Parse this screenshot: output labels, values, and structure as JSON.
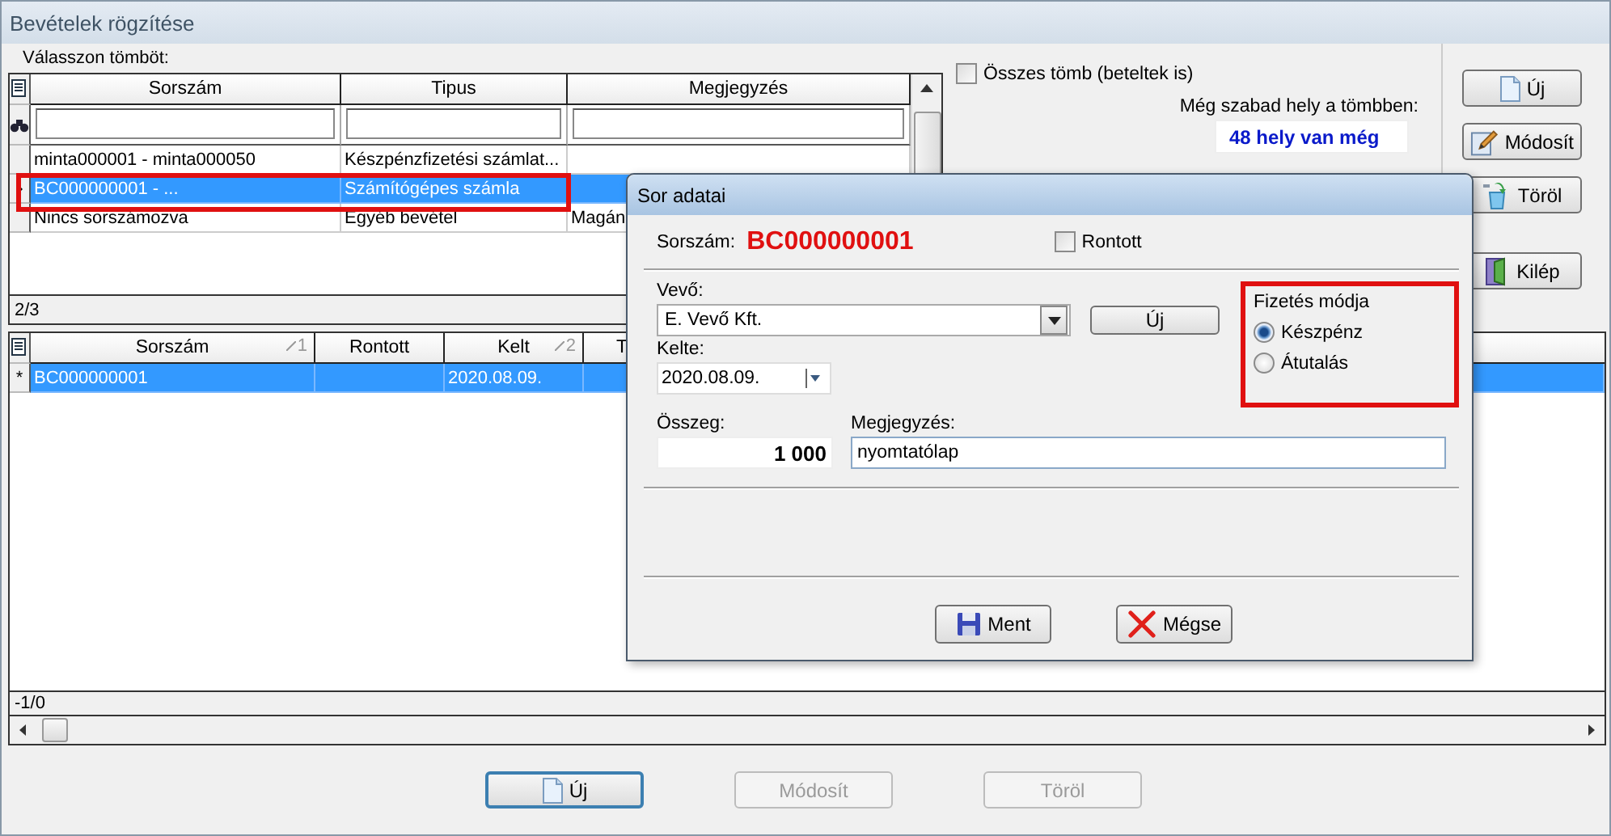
{
  "window": {
    "title": "Bevételek rögzítése"
  },
  "block_picker": {
    "label": "Válasszon tömböt:",
    "columns": [
      "Sorszám",
      "Tipus",
      "Megjegyzés"
    ],
    "rows": [
      {
        "sorszam": "minta000001 - minta000050",
        "tipus": "Készpénzfizetési számlat...",
        "selected": false
      },
      {
        "sorszam": "BC000000001 - ...",
        "tipus": "Számítógépes számla",
        "selected": true
      },
      {
        "sorszam": "Nincs sorszámozva",
        "tipus": "Egyéb bevétel",
        "megjegyzes": "Magán",
        "selected": false
      }
    ],
    "status": "2/3"
  },
  "all_blocks": {
    "label": "Összes tömb (beteltek is)",
    "checked": false
  },
  "free_space": {
    "label": "Még szabad hely a tömbben:",
    "value": "48 hely van még"
  },
  "side_buttons": [
    {
      "label": "Új",
      "kind": "new"
    },
    {
      "label": "Módosít",
      "kind": "edit"
    },
    {
      "label": "Töröl",
      "kind": "delete"
    },
    {
      "label": "Kilép",
      "kind": "exit"
    }
  ],
  "items_grid": {
    "columns": [
      {
        "label": "Sorszám",
        "sort": "1"
      },
      {
        "label": "Rontott"
      },
      {
        "label": "Kelt",
        "sort": "2"
      },
      {
        "label": "T"
      }
    ],
    "rows": [
      {
        "marker": "*",
        "sorszam": "BC000000001",
        "kelt": "2020.08.09.",
        "selected": true
      }
    ],
    "status": "-1/0"
  },
  "bottom_buttons": [
    {
      "label": "Új",
      "kind": "new",
      "disabled": false,
      "focused": true
    },
    {
      "label": "Módosít",
      "disabled": true,
      "focused": false
    },
    {
      "label": "Töröl",
      "disabled": true,
      "focused": false
    }
  ],
  "dialog": {
    "title": "Sor adatai",
    "number_label": "Sorszám:",
    "number": "BC000000001",
    "voided": {
      "label": "Rontott",
      "checked": false
    },
    "customer": {
      "label": "Vevő:",
      "value": "E. Vevő Kft.",
      "new_button": "Új"
    },
    "date": {
      "label": "Kelte:",
      "value": "2020.08.09."
    },
    "payment": {
      "title": "Fizetés módja",
      "options": [
        {
          "label": "Készpénz",
          "selected": true
        },
        {
          "label": "Átutalás",
          "selected": false
        }
      ]
    },
    "amount": {
      "label": "Összeg:",
      "value": "1 000"
    },
    "note": {
      "label": "Megjegyzés:",
      "value": "nyomtatólap"
    },
    "buttons": [
      {
        "label": "Ment",
        "kind": "save"
      },
      {
        "label": "Mégse",
        "kind": "cancel"
      }
    ]
  }
}
